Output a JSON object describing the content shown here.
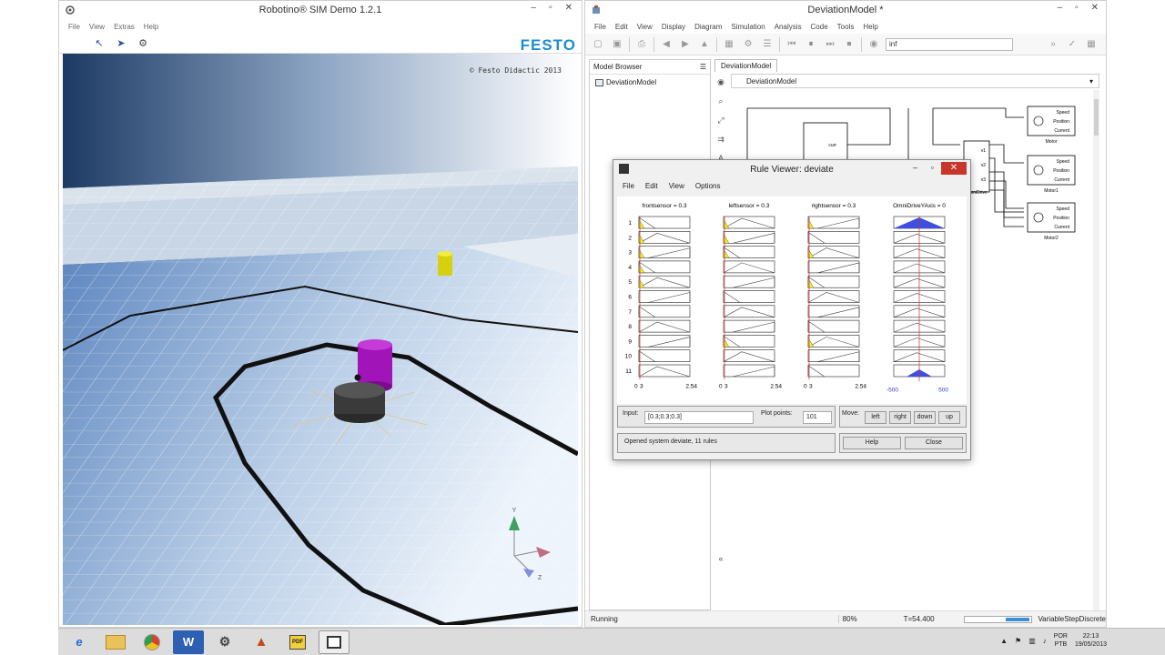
{
  "left_window": {
    "title": "Robotino® SIM Demo 1.2.1",
    "menu": [
      "File",
      "View",
      "Extras",
      "Help"
    ],
    "brand": "FESTO",
    "copyright": "© Festo Didactic 2013"
  },
  "right_window": {
    "title": "DeviationModel *",
    "menu": [
      "File",
      "Edit",
      "View",
      "Display",
      "Diagram",
      "Simulation",
      "Analysis",
      "Code",
      "Tools",
      "Help"
    ],
    "stop_time": "inf",
    "model_browser_label": "Model Browser",
    "browser_item": "DeviationModel",
    "canvas_tab": "DeviationModel",
    "breadcrumb": "DeviationModel",
    "blocks": {
      "ports": [
        "Speed",
        "Position",
        "Current"
      ],
      "motors": [
        "Motor",
        "Motor1",
        "Motor2"
      ],
      "omni_label": "OmniDrive",
      "v_ports": [
        "v1",
        "v2",
        "v3"
      ],
      "curr_label": "curr"
    },
    "status": {
      "state": "Running",
      "zoom": "80%",
      "time": "T=54.400",
      "solver": "VariableStepDiscrete"
    }
  },
  "rule_viewer": {
    "title": "Rule Viewer: deviate",
    "menu": [
      "File",
      "Edit",
      "View",
      "Options"
    ],
    "columns": [
      "frontsensor = 0.3",
      "leftsensor = 0.3",
      "rightsensor = 0.3",
      "OmniDriveYAxis = 0"
    ],
    "rule_numbers": [
      "1",
      "2",
      "3",
      "4",
      "5",
      "6",
      "7",
      "8",
      "9",
      "10",
      "11"
    ],
    "axis_min_label": "0",
    "axis_val_label": "3",
    "axis_max_label": "2.54",
    "out_min_label": "-500",
    "out_max_label": "500",
    "input_label": "Input:",
    "input_value": "[0.3;0.3;0.3]",
    "plot_points_label": "Plot points:",
    "plot_points_value": "101",
    "move_label": "Move:",
    "move_buttons": [
      "left",
      "right",
      "down",
      "up"
    ],
    "status_message": "Opened system deviate, 11 rules",
    "help_button": "Help",
    "close_button": "Close"
  },
  "taskbar": {
    "apps": [
      "e",
      "folder",
      "chrome",
      "W",
      "robotino",
      "matlab",
      "pdf",
      "window"
    ],
    "lang_top": "POR",
    "lang_bottom": "PTB",
    "time": "22:13",
    "date": "19/05/2013"
  },
  "colors": {
    "festo_blue": "#1a8fd0",
    "membership_yellow": "#f2ef2a",
    "output_blue": "#3d4fe0",
    "close_red": "#c8352a"
  }
}
